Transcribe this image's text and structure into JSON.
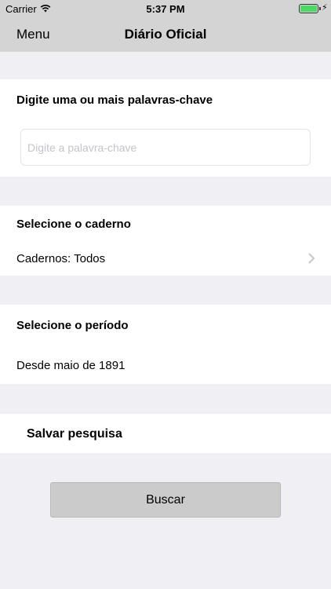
{
  "status_bar": {
    "carrier": "Carrier",
    "time": "5:37 PM",
    "battery_level": 1.0,
    "icons": [
      "wifi-icon",
      "battery-icon",
      "charging-bolt-icon"
    ]
  },
  "nav": {
    "menu_label": "Menu",
    "title": "Diário Oficial"
  },
  "keywords": {
    "heading": "Digite uma ou mais palavras-chave",
    "placeholder": "Digite a palavra-chave",
    "value": ""
  },
  "caderno": {
    "heading": "Selecione o caderno",
    "value": "Cadernos: Todos",
    "icon": "chevron-right-icon"
  },
  "periodo": {
    "heading": "Selecione o período",
    "value": "Desde maio de 1891"
  },
  "salvar": {
    "label": "Salvar pesquisa"
  },
  "actions": {
    "search_label": "Buscar"
  },
  "colors": {
    "background": "#efeff4",
    "nav_bar": "#d4d4d4",
    "card": "#ffffff",
    "button": "#cbcbcb",
    "battery": "#4cd964",
    "placeholder": "#c4c4c9"
  }
}
